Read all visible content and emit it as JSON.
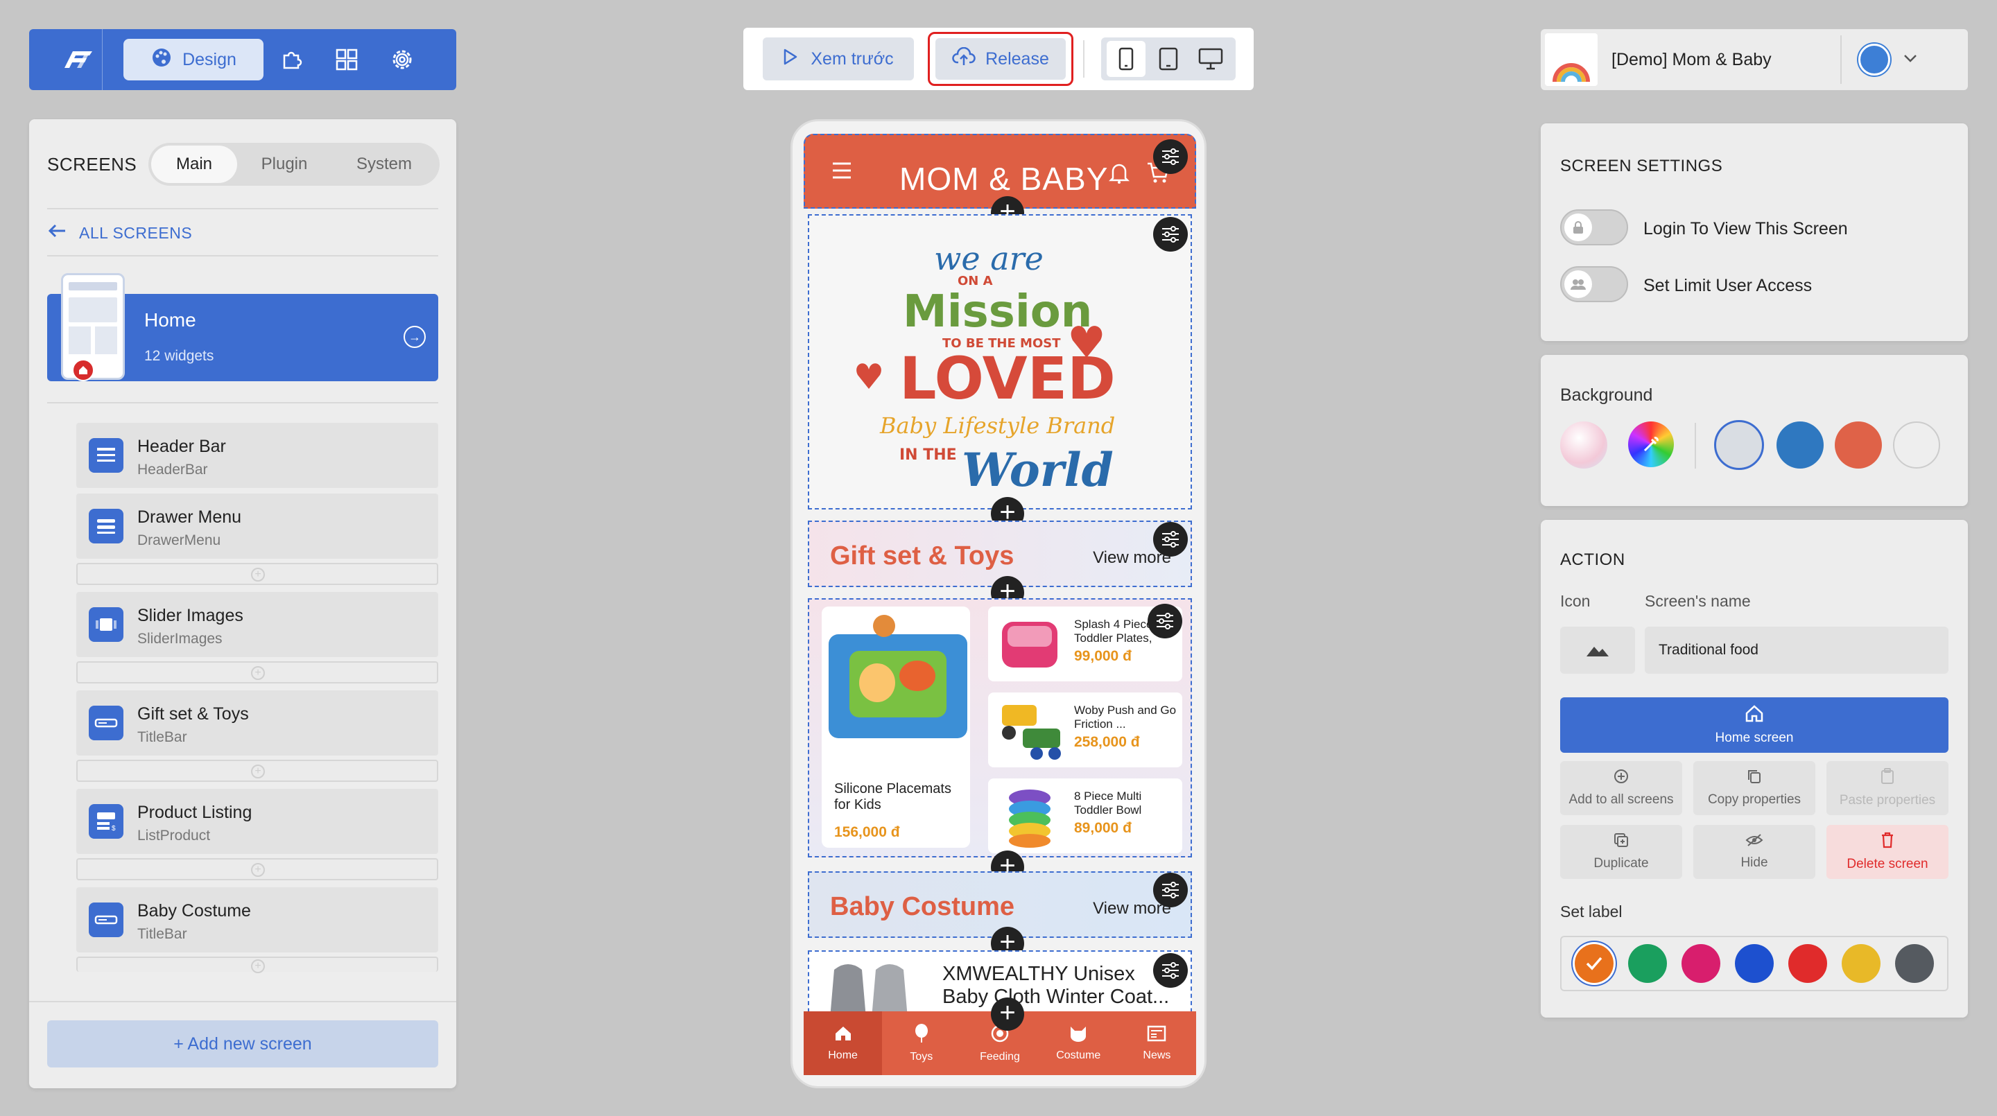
{
  "toolbar": {
    "design_label": "Design",
    "preview_label": "Xem trước",
    "release_label": "Release"
  },
  "project": {
    "name": "[Demo] Mom & Baby"
  },
  "left_panel": {
    "title": "SCREENS",
    "tabs": [
      "Main",
      "Plugin",
      "System"
    ],
    "active_tab": "Main",
    "all_screens_label": "ALL SCREENS",
    "home": {
      "title": "Home",
      "subtitle": "12 widgets"
    },
    "widgets": [
      {
        "title": "Header Bar",
        "type": "HeaderBar"
      },
      {
        "title": "Drawer Menu",
        "type": "DrawerMenu"
      },
      {
        "title": "Slider Images",
        "type": "SliderImages"
      },
      {
        "title": "Gift set & Toys",
        "type": "TitleBar"
      },
      {
        "title": "Product Listing",
        "type": "ListProduct"
      },
      {
        "title": "Baby Costume",
        "type": "TitleBar"
      }
    ],
    "add_screen_label": "+ Add new screen"
  },
  "phone": {
    "header_title": "MOM & BABY",
    "banner": {
      "line1": "we are",
      "line2": "ON A",
      "line3": "Mission",
      "line4": "TO BE THE MOST",
      "line5": "LOVED",
      "line6": "Baby Lifestyle Brand",
      "line7": "IN THE",
      "line8": "World"
    },
    "section1": {
      "title": "Gift set & Toys",
      "more": "View more"
    },
    "products": {
      "big": {
        "name": "Silicone Placemats for Kids",
        "price": "156,000 đ"
      },
      "small": [
        {
          "name": "Splash 4 Piece Toddler Plates,",
          "price": "99,000 đ"
        },
        {
          "name": "Woby Push and Go Friction ...",
          "price": "258,000 đ"
        },
        {
          "name": "8 Piece Multi Toddler Bowl",
          "price": "89,000 đ"
        }
      ]
    },
    "section2": {
      "title": "Baby Costume",
      "more": "View more"
    },
    "costume_item": {
      "name": "XMWEALTHY Unisex Baby Cloth Winter Coat..."
    },
    "tabs": [
      "Home",
      "Toys",
      "Feeding",
      "Costume",
      "News"
    ],
    "active_tab": "Home"
  },
  "screen_settings": {
    "title": "SCREEN SETTINGS",
    "toggles": [
      {
        "label": "Login To View This Screen",
        "on": false
      },
      {
        "label": "Set Limit User Access",
        "on": false
      }
    ]
  },
  "background": {
    "title": "Background",
    "swatches": [
      "#d9dde3",
      "#2f78c0",
      "#df6248",
      "#eeeeee"
    ],
    "selected": "#d9dde3"
  },
  "action": {
    "title": "ACTION",
    "icon_label": "Icon",
    "name_label": "Screen's name",
    "name_value": "Traditional food",
    "home_screen_label": "Home screen",
    "buttons": [
      {
        "label": "Add to all screens",
        "enabled": true
      },
      {
        "label": "Copy properties",
        "enabled": true
      },
      {
        "label": "Paste properties",
        "enabled": false
      },
      {
        "label": "Duplicate",
        "enabled": true
      },
      {
        "label": "Hide",
        "enabled": true
      },
      {
        "label": "Delete screen",
        "enabled": true
      }
    ],
    "set_label_title": "Set label",
    "label_colors": [
      "#e8711c",
      "#1a9f5e",
      "#d81e6d",
      "#1d50cf",
      "#e02b2b",
      "#e8b928",
      "#555a60"
    ],
    "selected_label_color": "#e8711c"
  },
  "colors": {
    "accent": "#3d6dd0",
    "brand": "#de5f44",
    "highlight": "#e02020"
  }
}
